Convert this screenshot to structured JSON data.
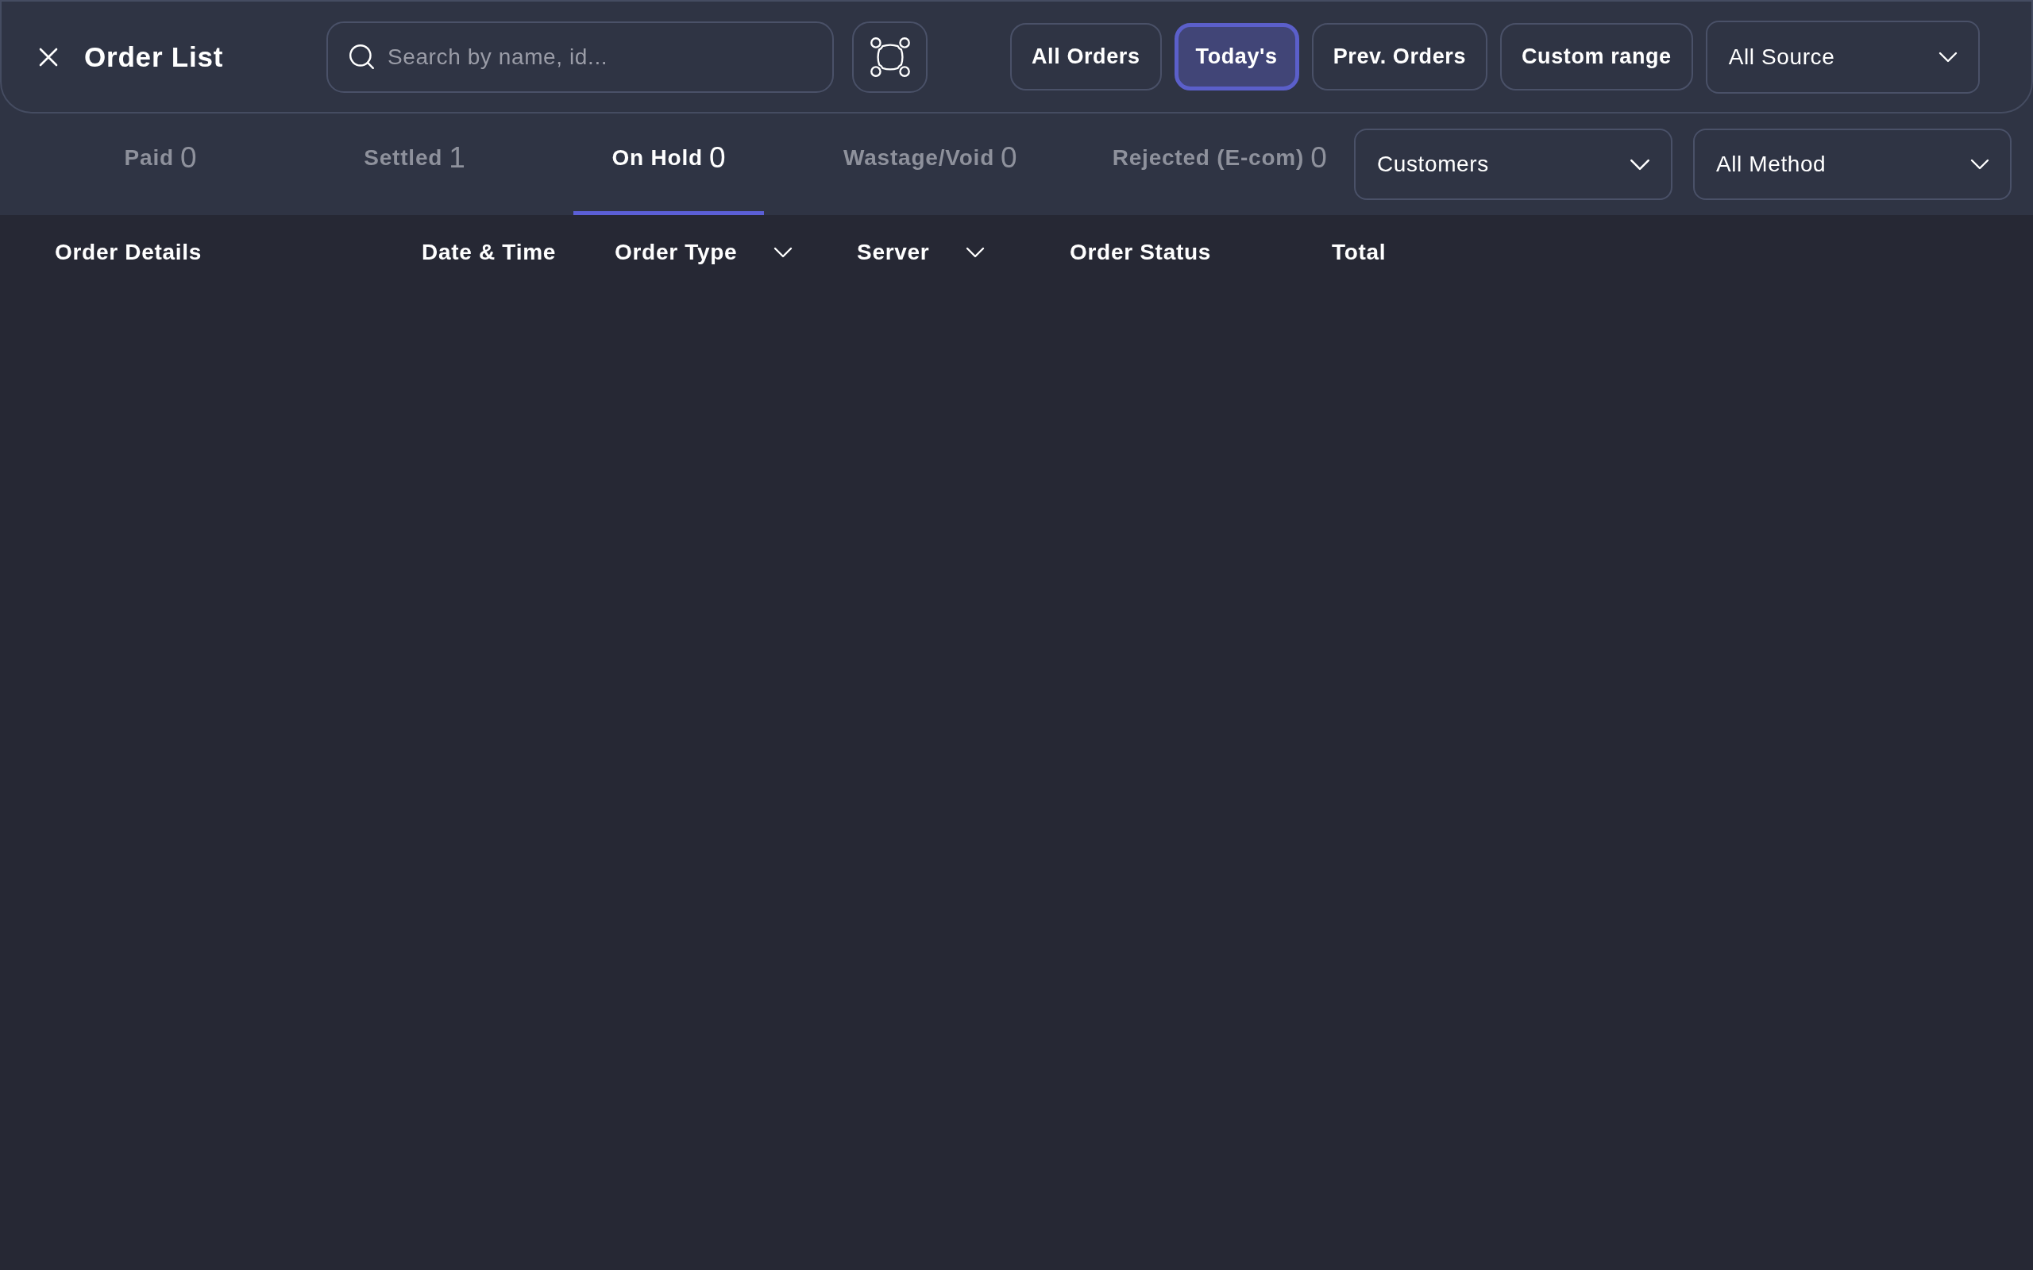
{
  "header": {
    "title": "Order List",
    "search": {
      "placeholder": "Search by name, id..."
    },
    "date_filters": [
      {
        "label": "All Orders",
        "selected": false
      },
      {
        "label": "Today's",
        "selected": true
      },
      {
        "label": "Prev. Orders",
        "selected": false
      },
      {
        "label": "Custom range",
        "selected": false
      }
    ],
    "source_filter": {
      "value": "All Source"
    }
  },
  "status_tabs": [
    {
      "label": "Paid",
      "count": "0",
      "selected": false
    },
    {
      "label": "Settled",
      "count": "1",
      "selected": false
    },
    {
      "label": "On Hold",
      "count": "0",
      "selected": true
    },
    {
      "label": "Wastage/Void",
      "count": "0",
      "selected": false
    },
    {
      "label": "Rejected (E-com)",
      "count": "0",
      "selected": false
    }
  ],
  "customer_filter": {
    "value": "Customers"
  },
  "method_filter": {
    "value": "All Method"
  },
  "table": {
    "columns": [
      {
        "label": "Order Details",
        "kind": "text"
      },
      {
        "label": "Date & Time",
        "kind": "text"
      },
      {
        "label": "Order Type",
        "kind": "filter"
      },
      {
        "label": "Server",
        "kind": "filter"
      },
      {
        "label": "Order Status",
        "kind": "text"
      },
      {
        "label": "Total",
        "kind": "text"
      }
    ]
  }
}
